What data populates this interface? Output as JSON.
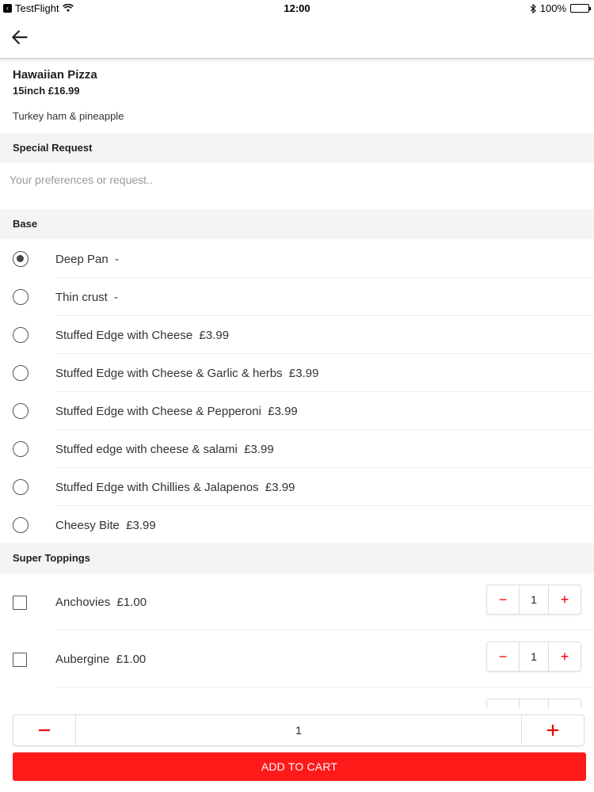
{
  "status_bar": {
    "app_back": "TestFlight",
    "time": "12:00",
    "battery": "100%"
  },
  "product": {
    "name": "Hawaiian Pizza",
    "size_price": "15inch £16.99",
    "description": "Turkey ham & pineapple"
  },
  "special_request": {
    "header": "Special Request",
    "placeholder": "Your preferences or request.."
  },
  "base": {
    "header": "Base",
    "selected_index": 0,
    "options": [
      {
        "label": "Deep Pan  -"
      },
      {
        "label": "Thin crust  -"
      },
      {
        "label": "Stuffed Edge with Cheese  £3.99"
      },
      {
        "label": "Stuffed Edge with Cheese & Garlic & herbs  £3.99"
      },
      {
        "label": "Stuffed Edge with Cheese & Pepperoni  £3.99"
      },
      {
        "label": "Stuffed edge with cheese & salami  £3.99"
      },
      {
        "label": "Stuffed Edge with Chillies & Jalapenos  £3.99"
      },
      {
        "label": "Cheesy Bite  £3.99"
      }
    ]
  },
  "toppings": {
    "header": "Super Toppings",
    "items": [
      {
        "label": "Anchovies  £1.00",
        "qty": "1",
        "minus": "−",
        "plus": "+"
      },
      {
        "label": "Aubergine  £1.00",
        "qty": "1",
        "minus": "−",
        "plus": "+"
      },
      {
        "label": "",
        "qty": "",
        "minus": "",
        "plus": ""
      }
    ]
  },
  "cart": {
    "quantity": "1",
    "add_label": "ADD TO CART"
  },
  "colors": {
    "accent": "#ff1a1a",
    "section_bg": "#f4f4f4"
  },
  "icons": {
    "nav_back": "arrow-left-icon",
    "radio": "radio-icon",
    "checkbox": "checkbox-icon",
    "minus": "minus-icon",
    "plus": "plus-icon"
  }
}
